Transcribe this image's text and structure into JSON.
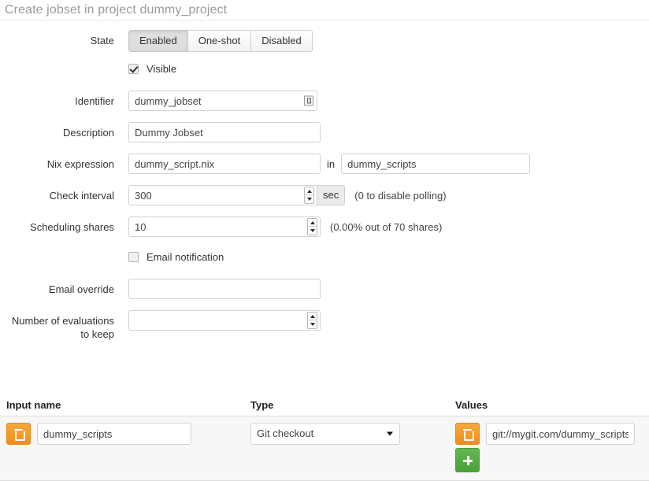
{
  "header": {
    "title": "Create jobset in project dummy_project"
  },
  "form": {
    "state": {
      "label": "State",
      "options": [
        "Enabled",
        "One-shot",
        "Disabled"
      ],
      "selected": "Enabled"
    },
    "visible": {
      "label": "Visible",
      "checked": true
    },
    "identifier": {
      "label": "Identifier",
      "value": "dummy_jobset",
      "placeholder": "",
      "glyph": "autofill-key-icon"
    },
    "description": {
      "label": "Description",
      "value": "Dummy Jobset",
      "placeholder": ""
    },
    "nix_expression": {
      "label": "Nix expression",
      "file_value": "dummy_script.nix",
      "file_placeholder": "",
      "joiner": "in",
      "input_value": "dummy_scripts",
      "input_placeholder": ""
    },
    "check_interval": {
      "label": "Check interval",
      "value": "300",
      "unit": "sec",
      "hint": "(0 to disable polling)"
    },
    "scheduling_shares": {
      "label": "Scheduling shares",
      "value": "10",
      "hint": "(0.00% out of 70 shares)"
    },
    "email_notification": {
      "label": "Email notification",
      "checked": false
    },
    "email_override": {
      "label": "Email override",
      "value": "",
      "placeholder": ""
    },
    "evaluations_to_keep": {
      "label": "Number of evaluations to keep",
      "label_line1": "Number of evaluations",
      "label_line2": "to keep",
      "value": "",
      "placeholder": ""
    }
  },
  "inputs_table": {
    "columns": {
      "name": "Input name",
      "type": "Type",
      "values": "Values"
    },
    "rows": [
      {
        "delete_icon": "trash-icon",
        "name": "dummy_scripts",
        "name_placeholder": "",
        "type": "Git checkout",
        "type_options": [
          "Git checkout"
        ],
        "values": [
          {
            "delete_icon": "trash-icon",
            "value": "git://mygit.com/dummy_scripts",
            "placeholder": ""
          }
        ],
        "add_icon": "plus-icon"
      }
    ]
  },
  "colors": {
    "orange": "#ef8f18",
    "green": "#4aa03b",
    "title_gray": "#9b9b9b",
    "row_bg": "#f7f7f7"
  }
}
